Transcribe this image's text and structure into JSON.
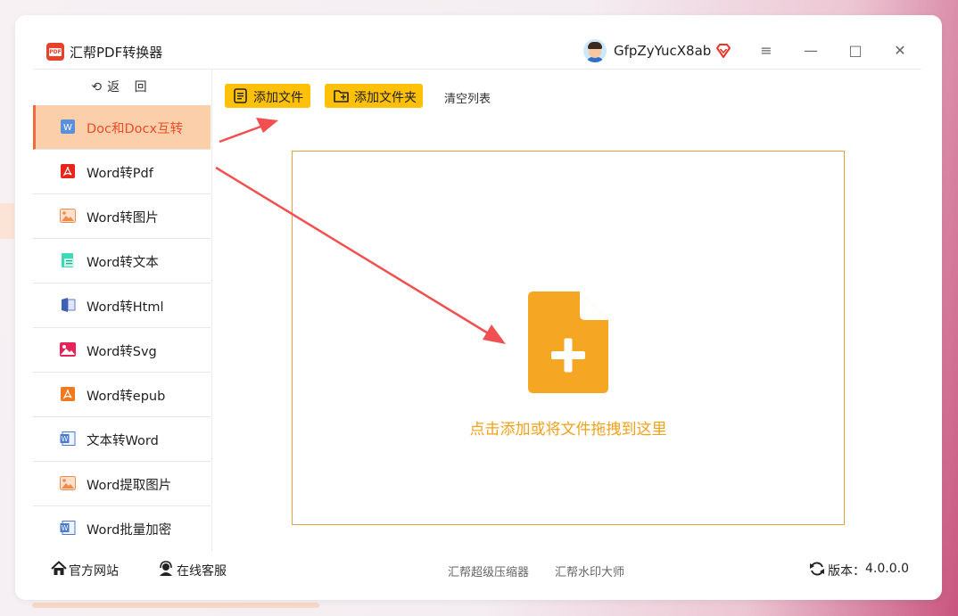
{
  "app": {
    "title": "汇帮PDF转换器",
    "logo_text": "PDF"
  },
  "user": {
    "name": "GfpZyYucX8ab"
  },
  "window_controls": {
    "menu": "≡",
    "minimize": "—",
    "maximize": "□",
    "close": "✕"
  },
  "sidebar": {
    "back_label": "⟲返 回",
    "items": [
      {
        "label": "Doc和Docx互转",
        "icon": "word-doc-icon",
        "active": true
      },
      {
        "label": "Word转Pdf",
        "icon": "pdf-icon"
      },
      {
        "label": "Word转图片",
        "icon": "image-icon"
      },
      {
        "label": "Word转文本",
        "icon": "text-file-icon"
      },
      {
        "label": "Word转Html",
        "icon": "html-icon"
      },
      {
        "label": "Word转Svg",
        "icon": "svg-image-icon"
      },
      {
        "label": "Word转epub",
        "icon": "epub-icon"
      },
      {
        "label": "文本转Word",
        "icon": "word-icon"
      },
      {
        "label": "Word提取图片",
        "icon": "image-icon"
      },
      {
        "label": "Word批量加密",
        "icon": "word-icon"
      }
    ]
  },
  "toolbar": {
    "add_file": "添加文件",
    "add_folder": "添加文件夹",
    "clear_list": "清空列表"
  },
  "dropzone": {
    "hint": "点击添加或将文件拖拽到这里"
  },
  "footer": {
    "website": "官方网站",
    "support": "在线客服",
    "compressor": "汇帮超级压缩器",
    "watermark": "汇帮水印大师",
    "version_label": "版本：",
    "version": "4.0.0.0"
  },
  "colors": {
    "accent": "#ffc107",
    "active_bg": "#fbcfa9",
    "active_text": "#f04b2a",
    "drop_border": "#e7a23b",
    "arrow": "#f25050"
  }
}
